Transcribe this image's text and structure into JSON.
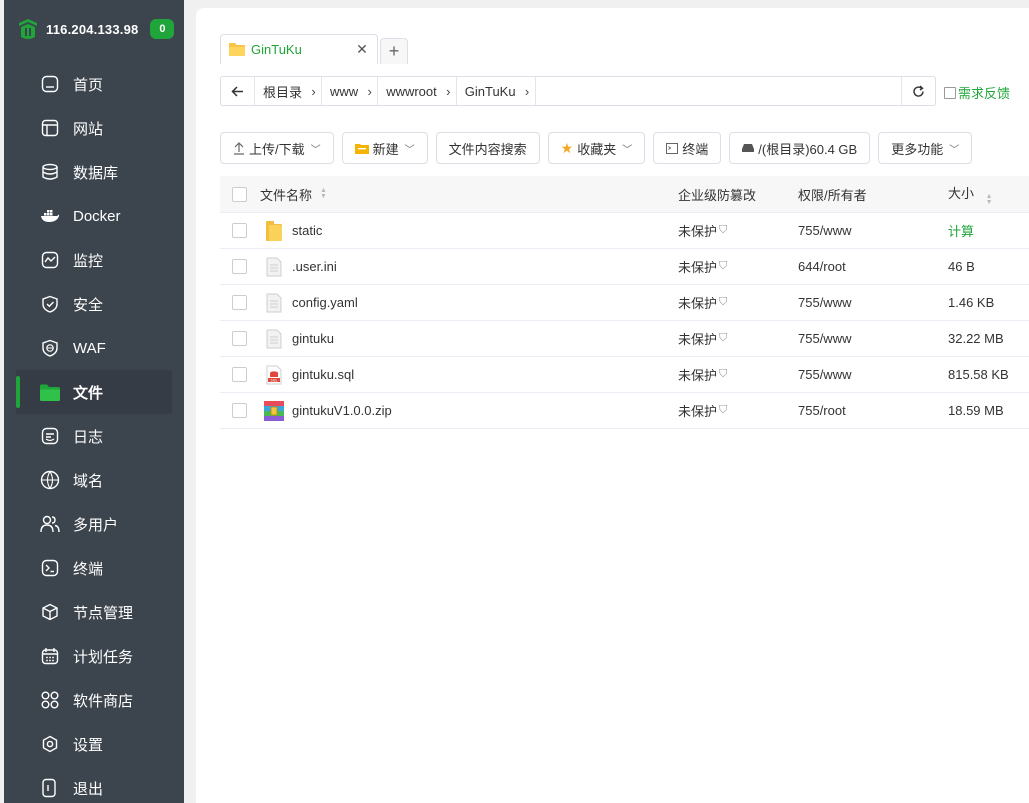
{
  "server": {
    "ip": "116.204.133.98",
    "alerts": "0"
  },
  "menu": [
    {
      "label": "首页",
      "icon": "home-icon",
      "active": false
    },
    {
      "label": "网站",
      "icon": "website-icon",
      "active": false
    },
    {
      "label": "数据库",
      "icon": "database-icon",
      "active": false
    },
    {
      "label": "Docker",
      "icon": "docker-icon",
      "active": false
    },
    {
      "label": "监控",
      "icon": "monitor-icon",
      "active": false
    },
    {
      "label": "安全",
      "icon": "shield-icon",
      "active": false
    },
    {
      "label": "WAF",
      "icon": "waf-icon",
      "active": false
    },
    {
      "label": "文件",
      "icon": "folder-icon",
      "active": true
    },
    {
      "label": "日志",
      "icon": "log-icon",
      "active": false
    },
    {
      "label": "域名",
      "icon": "www-icon",
      "active": false
    },
    {
      "label": "多用户",
      "icon": "users-icon",
      "active": false
    },
    {
      "label": "终端",
      "icon": "terminal-icon",
      "active": false
    },
    {
      "label": "节点管理",
      "icon": "node-icon",
      "active": false
    },
    {
      "label": "计划任务",
      "icon": "calendar-icon",
      "active": false
    },
    {
      "label": "软件商店",
      "icon": "apps-icon",
      "active": false
    },
    {
      "label": "设置",
      "icon": "settings-icon",
      "active": false
    },
    {
      "label": "退出",
      "icon": "logout-icon",
      "active": false
    }
  ],
  "tabs": [
    {
      "label": "GinTuKu"
    }
  ],
  "breadcrumb": [
    "根目录",
    "www",
    "wwwroot",
    "GinTuKu"
  ],
  "feedback_label": "需求反馈",
  "toolbar": {
    "upload": "上传/下载",
    "new": "新建",
    "search_content": "文件内容搜索",
    "favorites": "收藏夹",
    "terminal": "终端",
    "disk": "/(根目录)60.4 GB",
    "more": "更多功能"
  },
  "table": {
    "headers": {
      "name": "文件名称",
      "protect": "企业级防篡改",
      "perm": "权限/所有者",
      "size": "大小"
    },
    "rows": [
      {
        "name": "static",
        "type": "folder",
        "protect": "未保护",
        "perm": "755/www",
        "size": "计算"
      },
      {
        "name": ".user.ini",
        "type": "file",
        "protect": "未保护",
        "perm": "644/root",
        "size": "46 B"
      },
      {
        "name": "config.yaml",
        "type": "file",
        "protect": "未保护",
        "perm": "755/www",
        "size": "1.46 KB"
      },
      {
        "name": "gintuku",
        "type": "file",
        "protect": "未保护",
        "perm": "755/www",
        "size": "32.22 MB"
      },
      {
        "name": "gintuku.sql",
        "type": "sql",
        "protect": "未保护",
        "perm": "755/www",
        "size": "815.58 KB"
      },
      {
        "name": "gintukuV1.0.0.zip",
        "type": "zip",
        "protect": "未保护",
        "perm": "755/root",
        "size": "18.59 MB"
      }
    ]
  },
  "colors": {
    "accent": "#20a53a",
    "sidebar": "#3c444d"
  }
}
